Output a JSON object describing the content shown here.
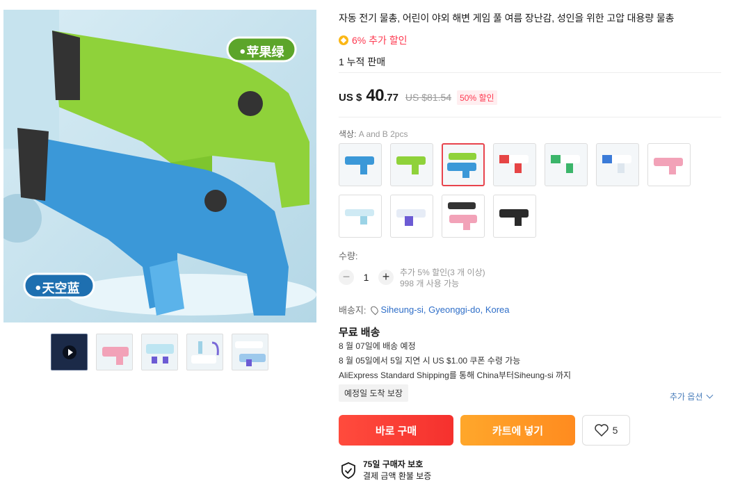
{
  "product": {
    "title": "자동 전기 물총, 어린이 야외 해변 게임 풀 여름 장난감, 성인을 위한 고압 대용량 물총",
    "extra_discount": "6% 추가 할인",
    "sold": "1 누적 판매",
    "price_currency": "US $",
    "price_whole": "40",
    "price_decimal": ".77",
    "original_price": "US $81.54",
    "discount_badge": "50% 할인"
  },
  "gallery": {
    "label_green": "•苹果绿",
    "label_blue": "•天空蓝",
    "thumbnails": [
      "video-thumb",
      "thumb-pink",
      "thumb-white-blue",
      "thumb-accessories",
      "thumb-blue-white"
    ]
  },
  "options": {
    "color_label": "색상:",
    "color_value": "A and B 2pcs",
    "swatch_names": [
      "blue",
      "green",
      "green-blue",
      "red-white",
      "green-white",
      "white-blue",
      "pink",
      "white-cyan",
      "white-purple",
      "pink-black",
      "black"
    ]
  },
  "quantity": {
    "label": "수량:",
    "value": "1",
    "minus": "−",
    "plus": "+",
    "note1": "추가 5% 할인(3 개 이상)",
    "note2": "998 개 사용 가능"
  },
  "shipping": {
    "label": "배송지:",
    "location": "Siheung-si, Gyeonggi-do, Korea",
    "free": "무료 배송",
    "line1": "8 월 07일에 배송 예정",
    "line2": "8 월 05일에서 5일 지연 시 US $1.00 쿠폰 수령 가능",
    "line3": "AliExpress Standard Shipping를 통해 China부터Siheung-si 까지",
    "guarantee": "예정일 도착 보장",
    "more": "추가 옵션"
  },
  "actions": {
    "buy_now": "바로 구매",
    "add_cart": "카트에 넣기",
    "wish_count": "5"
  },
  "protection": {
    "days": "75일",
    "title_rest": " 구매자 보호",
    "subtitle": "결제 금액 환불 보증"
  },
  "colors": {
    "accent_red": "#fd384f",
    "buy": "#f5312e",
    "cart": "#ff8b1f",
    "link": "#2e6ec8"
  }
}
